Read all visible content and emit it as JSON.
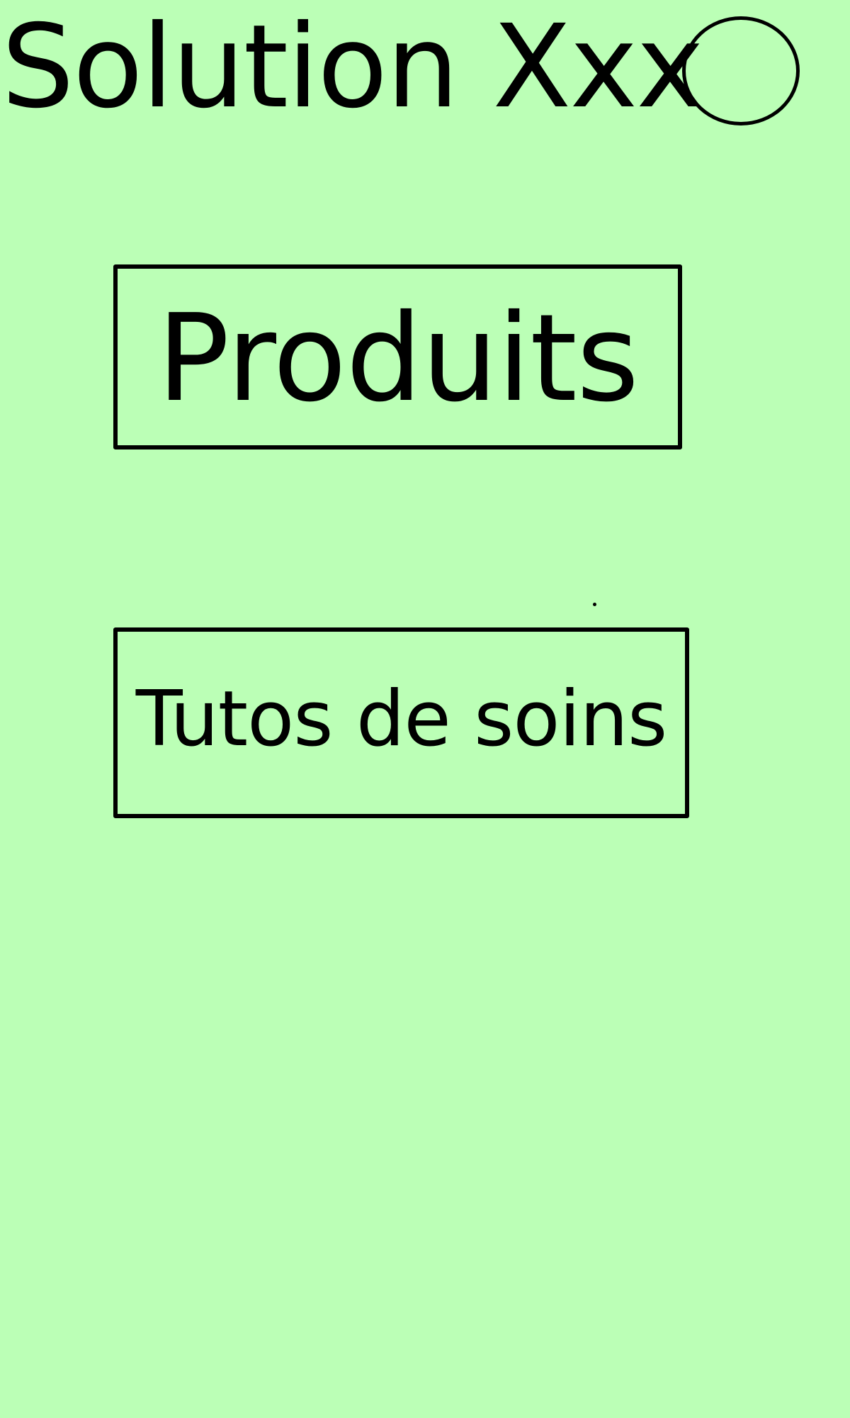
{
  "header": {
    "title": "Solution Xxx",
    "profile_icon": "circle-icon"
  },
  "nav": {
    "produits_label": "Produits",
    "tutos_label": "Tutos de soins"
  },
  "colors": {
    "background": "#bbffb6",
    "foreground": "#000000"
  }
}
